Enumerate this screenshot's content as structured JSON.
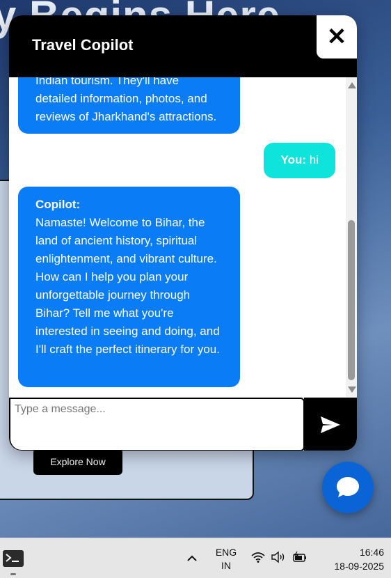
{
  "background": {
    "hero_text": "y Begins Here",
    "explore_button": "Explore Now"
  },
  "chat": {
    "title": "Travel Copilot",
    "close_icon": "close-icon",
    "messages": [
      {
        "role": "bot",
        "text": "Indian tourism. They'll have detailed information, photos, and reviews of Jharkhand's attractions."
      },
      {
        "role": "user",
        "sender": "You:",
        "text": "hi"
      },
      {
        "role": "bot",
        "sender": "Copilot:",
        "text": "Namaste! Welcome to Bihar, the land of ancient history, spiritual enlightenment, and vibrant culture. How can I help you plan your unforgettable journey through Bihar? Tell me what you're interested in seeing and doing, and I'll craft the perfect itinerary for you."
      }
    ],
    "input_placeholder": "Type a message...",
    "send_icon": "send-icon",
    "colors": {
      "header": "#000000",
      "bot_bubble": "#0a7cf5",
      "user_bubble": "#0ee3dc",
      "fab": "#0a64d6"
    }
  },
  "fab": {
    "icon": "chat-bubble-icon"
  },
  "taskbar": {
    "lang_line1": "ENG",
    "lang_line2": "IN",
    "time": "16:46",
    "date": "18-09-2025",
    "icons": [
      "terminal-icon",
      "chevron-up-icon",
      "wifi-icon",
      "volume-icon",
      "battery-icon"
    ]
  }
}
